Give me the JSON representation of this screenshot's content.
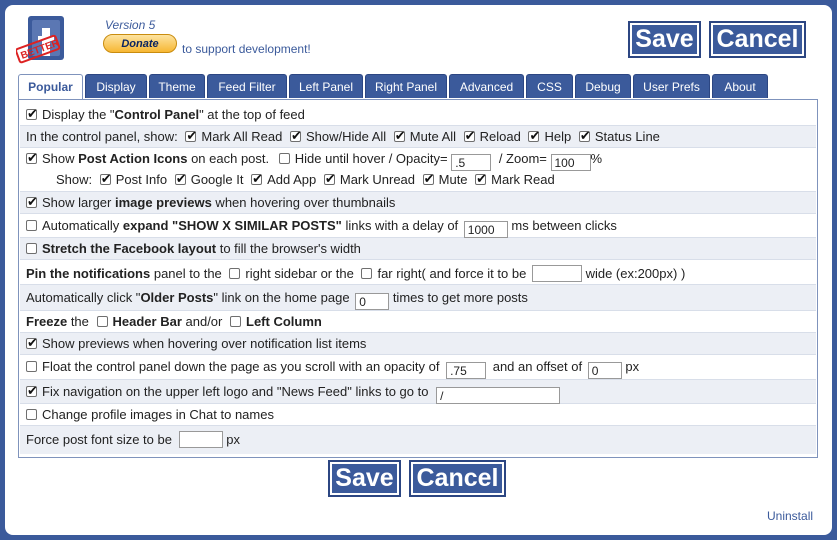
{
  "header": {
    "version": "Version 5",
    "donate_label": "Donate",
    "support_text": "to support development!",
    "save_label": "Save",
    "cancel_label": "Cancel"
  },
  "tabs": [
    "Popular",
    "Display",
    "Theme",
    "Feed Filter",
    "Left Panel",
    "Right Panel",
    "Advanced",
    "CSS",
    "Debug",
    "User Prefs",
    "About"
  ],
  "rows": {
    "r1": {
      "text1": "Display the \"",
      "bold": "Control Panel",
      "text2": "\" at the top of feed"
    },
    "r2": {
      "prefix": "In the control panel, show:",
      "items": [
        "Mark All Read",
        "Show/Hide All",
        "Mute All",
        "Reload",
        "Help",
        "Status Line"
      ]
    },
    "r3": {
      "text1": "Show ",
      "bold": "Post Action Icons",
      "text2": " on each post.",
      "hide": "Hide until hover / Opacity=",
      "opacity": ".5",
      "zoom": "/ Zoom=",
      "zoom_value": "100",
      "pct": "%",
      "show": "Show:",
      "items": [
        "Post Info",
        "Google It",
        "Add App",
        "Mark Unread",
        "Mute",
        "Mark Read"
      ]
    },
    "r4": {
      "text1": "Show larger ",
      "bold": "image previews",
      "text2": " when hovering over thumbnails"
    },
    "r5": {
      "text1": "Automatically ",
      "bold": "expand \"SHOW X SIMILAR POSTS\"",
      "text2": " links with a delay of",
      "delay": "1000",
      "text3": "ms between clicks"
    },
    "r6": {
      "bold": "Stretch the Facebook layout",
      "text2": " to fill the browser's width"
    },
    "r7": {
      "bold": "Pin the notifications",
      "text1": " panel to the",
      "opt1": "right sidebar or the",
      "opt2": "far right( and force it to be",
      "text3": "wide (ex:200px) )"
    },
    "r8": {
      "text1": "Automatically click \"",
      "bold": "Older Posts",
      "text2": "\" link on the home page",
      "count": "0",
      "text3": "times to get more posts"
    },
    "r9": {
      "bold": "Freeze",
      "text1": " the",
      "bold2": "Header Bar",
      "text2": " and/or",
      "bold3": "Left Column"
    },
    "r10": {
      "text1": "Show previews when hovering over notification list items"
    },
    "r11": {
      "text1": "Float the control panel down the page as you scroll with an opacity of",
      "opacity": ".75",
      "text2": "and an offset of",
      "offset": "0",
      "text3": "px"
    },
    "r12": {
      "text1": "Fix navigation on the upper left logo and \"News Feed\" links to go to",
      "url": "/"
    },
    "r13": {
      "text1": "Change profile images in Chat to names"
    },
    "r14": {
      "text1": "Force post font size to be",
      "text2": "px"
    }
  },
  "footer": {
    "save_label": "Save",
    "cancel_label": "Cancel",
    "uninstall": "Uninstall"
  },
  "colors": {
    "brand": "#3b5a9b",
    "alt_row": "#eceff5",
    "donate": "#f7b733"
  }
}
